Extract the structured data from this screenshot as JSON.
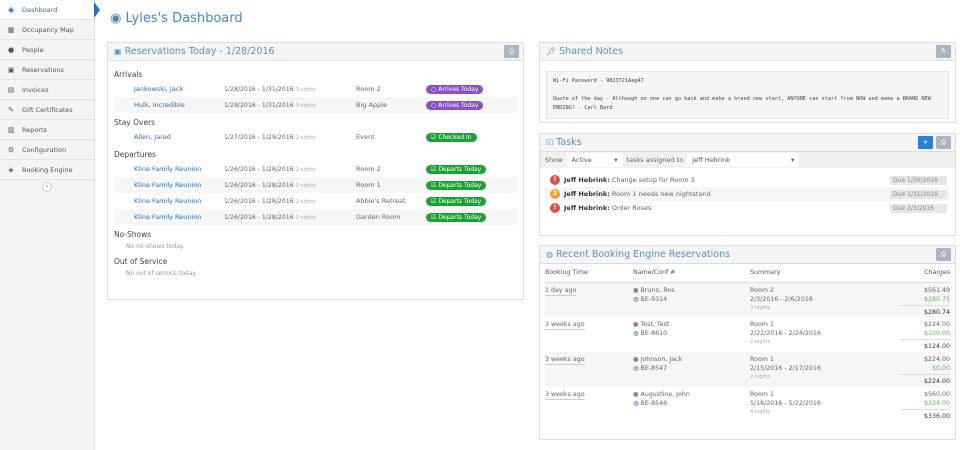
{
  "sidebar": {
    "items": [
      {
        "label": "Dashboard",
        "icon": "dashboard-icon",
        "glyph": "◉",
        "active": true
      },
      {
        "label": "Occupancy Map",
        "icon": "calendar-icon",
        "glyph": "▦"
      },
      {
        "label": "People",
        "icon": "user-icon",
        "glyph": "●"
      },
      {
        "label": "Reservations",
        "icon": "briefcase-icon",
        "glyph": "▣"
      },
      {
        "label": "Invoices",
        "icon": "table-icon",
        "glyph": "▤"
      },
      {
        "label": "Gift Certificates",
        "icon": "gift-certificate-icon",
        "glyph": "✎"
      },
      {
        "label": "Reports",
        "icon": "bar-chart-icon",
        "glyph": "▥"
      },
      {
        "label": "Configuration",
        "icon": "cogs-icon",
        "glyph": "⚙"
      },
      {
        "label": "Booking Engine",
        "icon": "cube-icon",
        "glyph": "◈"
      }
    ],
    "collapse": "«"
  },
  "page": {
    "title": "Lyles's Dashboard"
  },
  "reservations": {
    "title": "Reservations Today - 1/28/2016",
    "print": "⎙",
    "sections": [
      {
        "label": "Arrivals",
        "rows": [
          {
            "name": "Jankowski, Jack",
            "dates": "1/28/2016 - 1/31/2016",
            "nights": "3 nights",
            "room": "Room 2",
            "status": "Arrives Today",
            "glyph": "○",
            "color": "#8a4fc4"
          },
          {
            "name": "Hulk, Incredible",
            "dates": "1/28/2016 - 1/31/2016",
            "nights": "3 nights",
            "room": "Big Apple",
            "status": "Arrives Today",
            "glyph": "○",
            "color": "#8a4fc4"
          }
        ]
      },
      {
        "label": "Stay Overs",
        "rows": [
          {
            "name": "Allen, Jared",
            "dates": "1/27/2016 - 1/29/2016",
            "nights": "2 nights",
            "room": "Event",
            "status": "Checked In",
            "glyph": "☑",
            "color": "#1e9e3a"
          }
        ]
      },
      {
        "label": "Departures",
        "rows": [
          {
            "name": "Kline Family Reunion",
            "dates": "1/26/2016 - 1/28/2016",
            "nights": "2 nights",
            "room": "Room 2",
            "status": "Departs Today",
            "glyph": "☑",
            "color": "#1e9e3a"
          },
          {
            "name": "Kline Family Reunion",
            "dates": "1/26/2016 - 1/28/2016",
            "nights": "2 nights",
            "room": "Room 1",
            "status": "Departs Today",
            "glyph": "☑",
            "color": "#1e9e3a"
          },
          {
            "name": "Kline Family Reunion",
            "dates": "1/26/2016 - 1/28/2016",
            "nights": "2 nights",
            "room": "Abbie's Retreat",
            "status": "Departs Today",
            "glyph": "☑",
            "color": "#1e9e3a"
          },
          {
            "name": "Kline Family Reunion",
            "dates": "1/26/2016 - 1/28/2016",
            "nights": "2 nights",
            "room": "Garden Room",
            "status": "Departs Today",
            "glyph": "☑",
            "color": "#1e9e3a"
          }
        ]
      },
      {
        "label": "No-Shows",
        "empty": "No no-shows today."
      },
      {
        "label": "Out of Service",
        "empty": "No out of service today."
      }
    ]
  },
  "notes": {
    "title": "Shared Notes",
    "line1": "Wi-Fi Password - 9823721Aag47",
    "line2": "Quote of the day - Although no one can go back and make a brand new start, ANYONE can start from NOW and make a BRAND NEW ENDING! - Carl Bard"
  },
  "tasks": {
    "title": "Tasks",
    "show_label": "Show",
    "show_value": "Active",
    "assigned_label": "tasks assigned to",
    "assigned_value": "Jeff Hebrink",
    "items": [
      {
        "who": "Jeff Hebrink:",
        "text": "Change setup for Room 3",
        "due": "Due 1/30/2016",
        "priority": "!",
        "color": "#d9534f"
      },
      {
        "who": "Jeff Hebrink:",
        "text": "Room 1 needs new nightstand",
        "due": "Due 1/31/2016",
        "priority": "2",
        "color": "#f0a030"
      },
      {
        "who": "Jeff Hebrink:",
        "text": "Order Roses",
        "due": "Due 2/3/2016",
        "priority": "!",
        "color": "#d9534f"
      }
    ]
  },
  "booking": {
    "title": "Recent Booking Engine Reservations",
    "headers": [
      "Booking Time",
      "Name/Conf #",
      "Summary",
      "Charges"
    ],
    "rows": [
      {
        "time": "1 day ago",
        "name": "Bruno, Ros",
        "conf": "BE-9314",
        "room": "Room 2",
        "dates": "2/3/2016 - 2/6/2016",
        "nights": "3 nights",
        "total": "$561.49",
        "paid": "$280.75",
        "balance": "$280.74"
      },
      {
        "time": "3 weeks ago",
        "name": "Test, Test",
        "conf": "BE-8610",
        "room": "Room 1",
        "dates": "2/22/2016 - 2/24/2016",
        "nights": "2 nights",
        "total": "$224.00",
        "paid": "$100.00",
        "balance": "$124.00"
      },
      {
        "time": "3 weeks ago",
        "name": "Johnson, Jack",
        "conf": "BE-8547",
        "room": "Room 1",
        "dates": "2/15/2016 - 2/17/2016",
        "nights": "2 nights",
        "total": "$224.00",
        "paid": "$0.00",
        "balance": "$224.00"
      },
      {
        "time": "3 weeks ago",
        "name": "Augustine, John",
        "conf": "BE-8546",
        "room": "Room 1",
        "dates": "5/18/2016 - 5/22/2016",
        "nights": "4 nights",
        "total": "$560.00",
        "paid": "$224.00",
        "balance": "$336.00"
      }
    ]
  }
}
